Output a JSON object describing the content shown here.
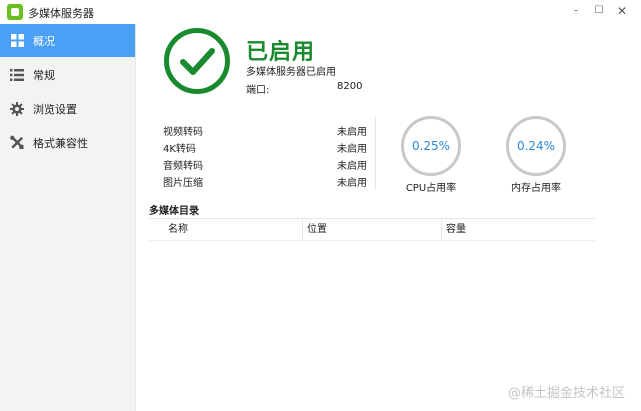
{
  "window": {
    "title": "多媒体服务器",
    "minimize": "–",
    "maximize": "☐",
    "close": "✕"
  },
  "sidebar": {
    "items": [
      {
        "label": "概况",
        "icon": "grid-icon",
        "active": true
      },
      {
        "label": "常规",
        "icon": "list-icon",
        "active": false
      },
      {
        "label": "浏览设置",
        "icon": "gear-icon",
        "active": false
      },
      {
        "label": "格式兼容性",
        "icon": "tools-icon",
        "active": false
      }
    ]
  },
  "status": {
    "title": "已启用",
    "subtitle": "多媒体服务器已启用",
    "port_label": "端口:",
    "port_value": "8200",
    "icon": "checkmark-icon",
    "color": "#1a8a2e"
  },
  "features": [
    {
      "label": "视频转码",
      "value": "未启用"
    },
    {
      "label": "4K转码",
      "value": "未启用"
    },
    {
      "label": "音频转码",
      "value": "未启用"
    },
    {
      "label": "图片压缩",
      "value": "未启用"
    }
  ],
  "gauges": {
    "cpu": {
      "value": "0.25%",
      "label": "CPU占用率"
    },
    "memory": {
      "value": "0.24%",
      "label": "内存占用率"
    }
  },
  "media_dirs": {
    "title": "多媒体目录",
    "columns": [
      "名称",
      "位置",
      "容量"
    ],
    "rows": []
  },
  "watermark": "@稀土掘金技术社区",
  "colors": {
    "accent": "#4aa0f5",
    "success": "#1a8a2e",
    "gauge_text": "#2a8ad8"
  }
}
